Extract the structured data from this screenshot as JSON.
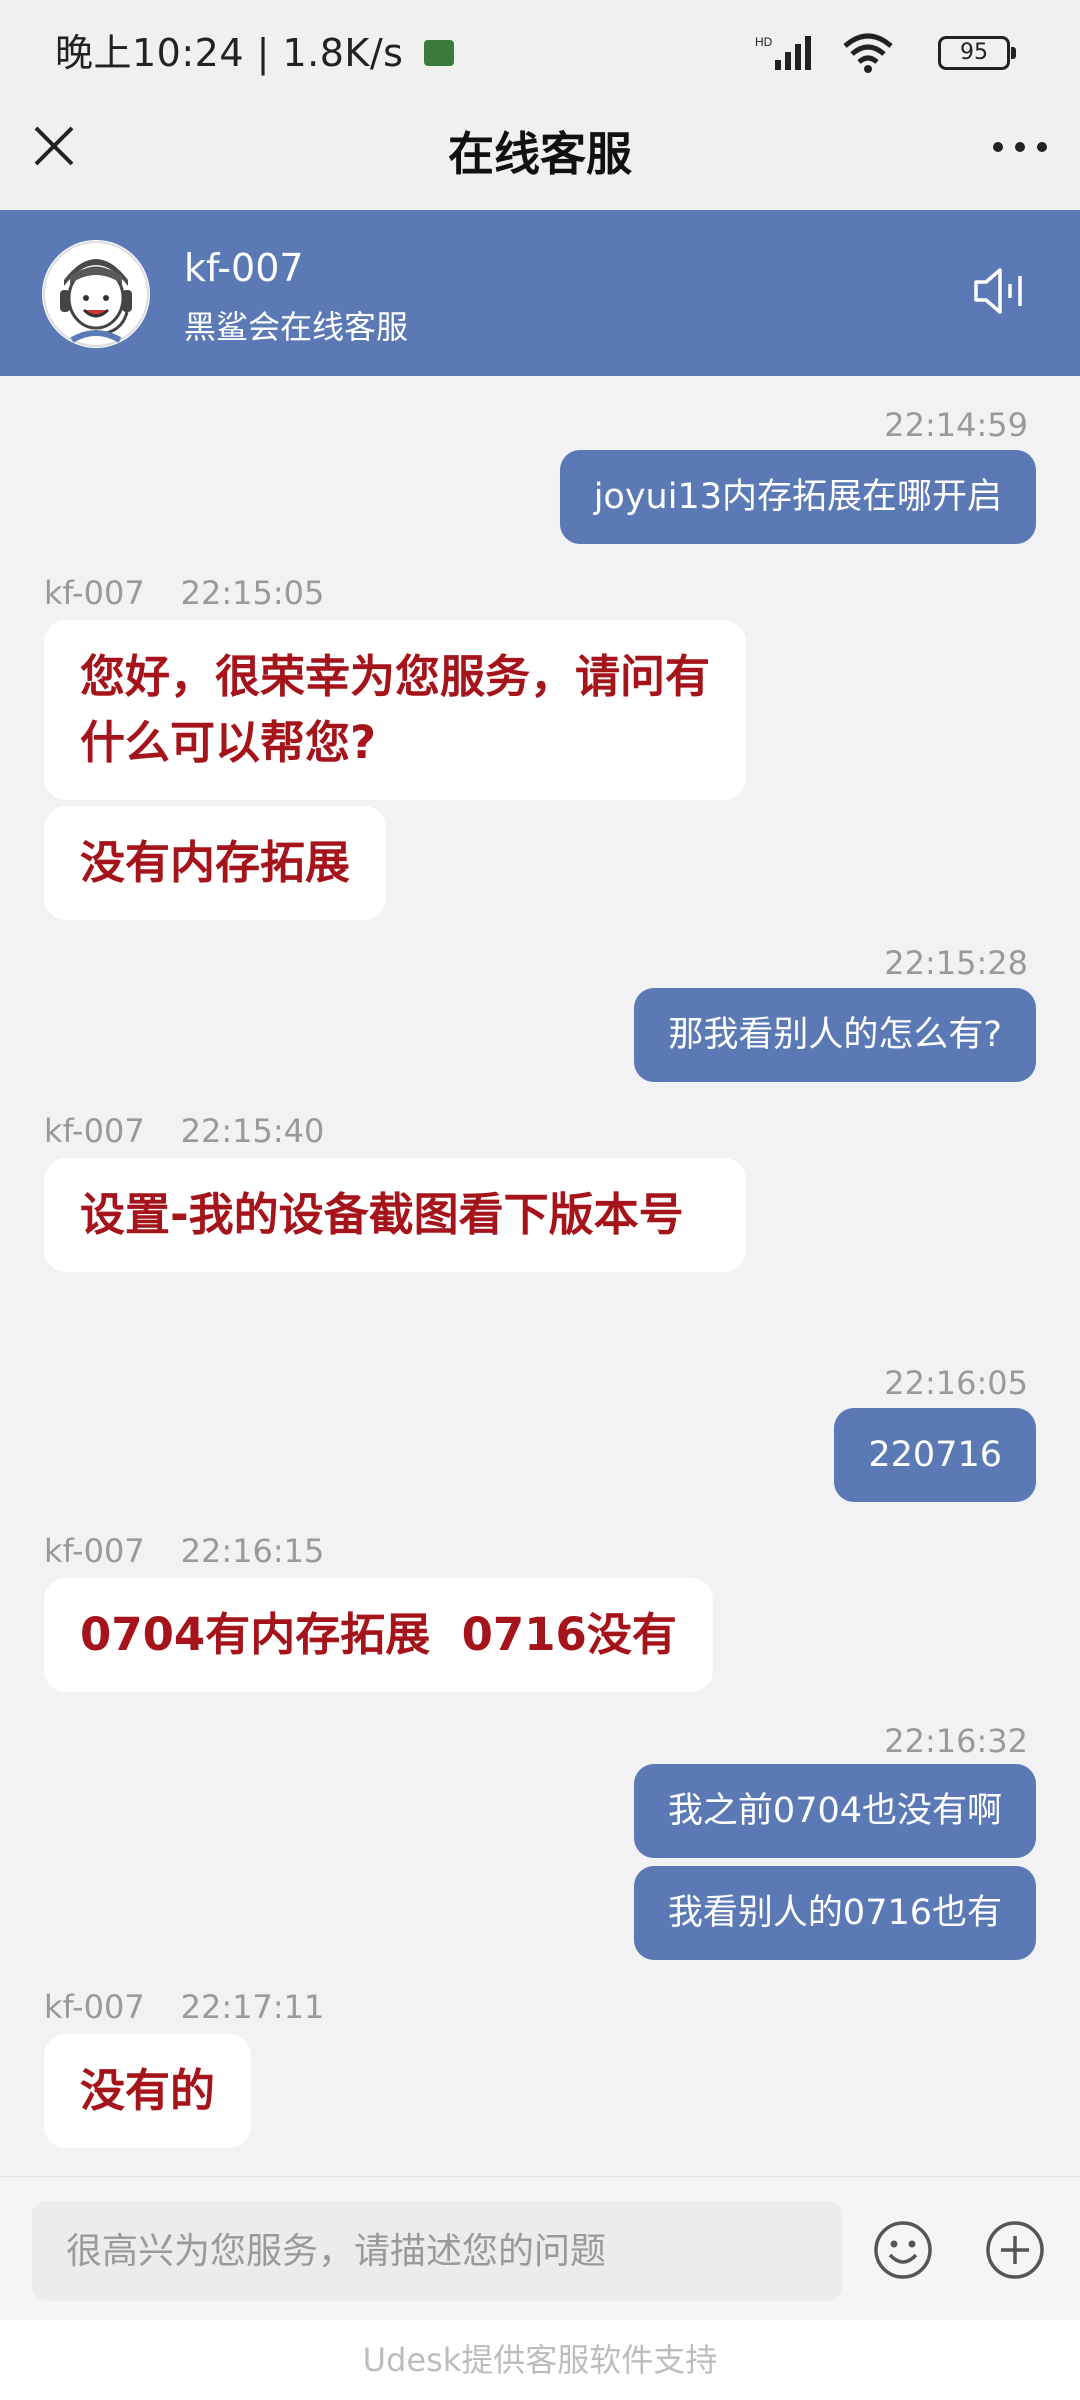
{
  "status": {
    "time_speed": "晚上10:24 | 1.8K/s",
    "battery": "95"
  },
  "header": {
    "title": "在线客服"
  },
  "agent": {
    "name": "kf-007",
    "subtitle": "黑鲨会在线客服"
  },
  "messages": {
    "m1": {
      "time": "22:14:59",
      "text": "joyui13内存拓展在哪开启"
    },
    "m2": {
      "sender": "kf-007",
      "time": "22:15:05",
      "text": "您好，很荣幸为您服务，请问有什么可以帮您?",
      "text2": "没有内存拓展"
    },
    "m3": {
      "time": "22:15:28",
      "text": "那我看别人的怎么有?"
    },
    "m4": {
      "sender": "kf-007",
      "time": "22:15:40",
      "text": "设置-我的设备截图看下版本号"
    },
    "m5": {
      "time": "22:16:05",
      "text": "220716"
    },
    "m6": {
      "sender": "kf-007",
      "time": "22:16:15",
      "text": "0704有内存拓展  0716没有"
    },
    "m7": {
      "time": "22:16:32",
      "text": "我之前0704也没有啊",
      "text2": "我看别人的0716也有"
    },
    "m8": {
      "sender": "kf-007",
      "time": "22:17:11",
      "text": "没有的"
    }
  },
  "input": {
    "placeholder": "很高兴为您服务，请描述您的问题"
  },
  "footer": {
    "text": "Udesk提供客服软件支持"
  },
  "colors": {
    "accent": "#5b7ab5",
    "agent_text": "#a5141b"
  },
  "icons": [
    "close-icon",
    "more-icon",
    "speaker-icon",
    "emoji-icon",
    "plus-icon"
  ]
}
